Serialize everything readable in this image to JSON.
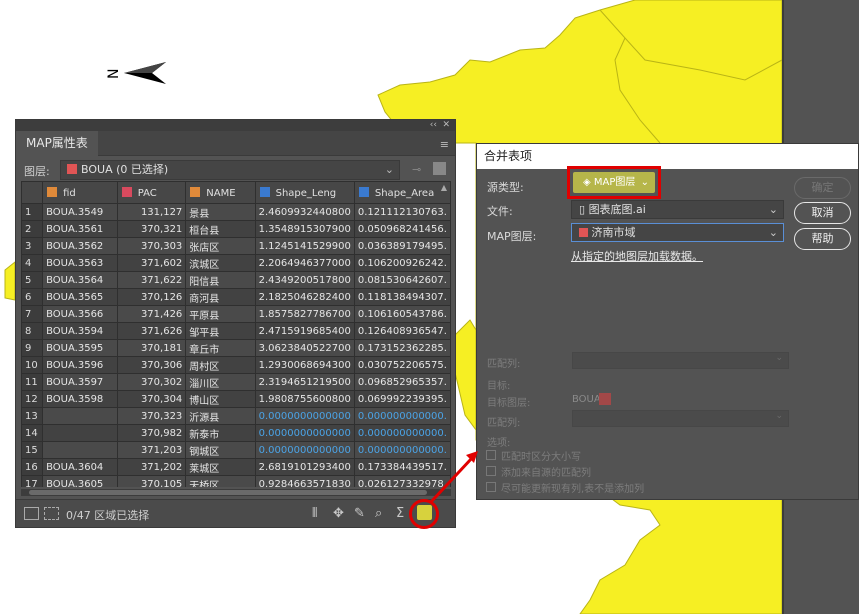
{
  "attr_panel": {
    "title": "MAP属性表",
    "layer_label": "图层:",
    "layer_value": "BOUA (0 已选择)",
    "columns": [
      "fid",
      "PAC",
      "NAME",
      "Shape_Leng",
      "Shape_Area"
    ],
    "rows": [
      {
        "n": "1",
        "fid": "BOUA.3549",
        "pac": "131,127",
        "name": "景县",
        "len": "2.4609932440800",
        "area": "0.121112130763."
      },
      {
        "n": "2",
        "fid": "BOUA.3561",
        "pac": "370,321",
        "name": "桓台县",
        "len": "1.3548915307900",
        "area": "0.050968241456."
      },
      {
        "n": "3",
        "fid": "BOUA.3562",
        "pac": "370,303",
        "name": "张店区",
        "len": "1.1245141529900",
        "area": "0.036389179495."
      },
      {
        "n": "4",
        "fid": "BOUA.3563",
        "pac": "371,602",
        "name": "滨城区",
        "len": "2.2064946377000",
        "area": "0.106200926242."
      },
      {
        "n": "5",
        "fid": "BOUA.3564",
        "pac": "371,622",
        "name": "阳信县",
        "len": "2.4349200517800",
        "area": "0.081530642607."
      },
      {
        "n": "6",
        "fid": "BOUA.3565",
        "pac": "370,126",
        "name": "商河县",
        "len": "2.1825046282400",
        "area": "0.118138494307."
      },
      {
        "n": "7",
        "fid": "BOUA.3566",
        "pac": "371,426",
        "name": "平原县",
        "len": "1.8575827786700",
        "area": "0.106160543786."
      },
      {
        "n": "8",
        "fid": "BOUA.3594",
        "pac": "371,626",
        "name": "邹平县",
        "len": "2.4715919685400",
        "area": "0.126408936547."
      },
      {
        "n": "9",
        "fid": "BOUA.3595",
        "pac": "370,181",
        "name": "章丘市",
        "len": "3.0623840522700",
        "area": "0.173152362285."
      },
      {
        "n": "10",
        "fid": "BOUA.3596",
        "pac": "370,306",
        "name": "周村区",
        "len": "1.2930068694300",
        "area": "0.030752206575."
      },
      {
        "n": "11",
        "fid": "BOUA.3597",
        "pac": "370,302",
        "name": "淄川区",
        "len": "2.3194651219500",
        "area": "0.096852965357."
      },
      {
        "n": "12",
        "fid": "BOUA.3598",
        "pac": "370,304",
        "name": "博山区",
        "len": "1.9808755600800",
        "area": "0.069992239395."
      },
      {
        "n": "13",
        "fid": "",
        "pac": "370,323",
        "name": "沂源县",
        "len": "0.0000000000000",
        "area": "0.000000000000."
      },
      {
        "n": "14",
        "fid": "",
        "pac": "370,982",
        "name": "新泰市",
        "len": "0.0000000000000",
        "area": "0.000000000000."
      },
      {
        "n": "15",
        "fid": "",
        "pac": "371,203",
        "name": "钢城区",
        "len": "0.0000000000000",
        "area": "0.000000000000."
      },
      {
        "n": "16",
        "fid": "BOUA.3604",
        "pac": "371,202",
        "name": "莱城区",
        "len": "2.6819101293400",
        "area": "0.173384439517."
      },
      {
        "n": "17",
        "fid": "BOUA.3605",
        "pac": "370,105",
        "name": "天桥区",
        "len": "0.9284663571830",
        "area": "0.026127332978."
      }
    ],
    "status_text": "0/47 区域已选择"
  },
  "merge_dialog": {
    "title": "合并表项",
    "source_type_label": "源类型:",
    "source_type_value": "MAP图层",
    "file_label": "文件:",
    "file_value": "图表底图.ai",
    "map_layer_label": "MAP图层:",
    "map_layer_value": "济南市域",
    "load_link": "从指定的地图层加载数据。",
    "ok_label": "确定",
    "cancel_label": "取消",
    "help_label": "帮助",
    "match_col_label": "匹配列:",
    "target_label": "目标:",
    "target_layer_label": "目标图层:",
    "target_layer_value": "BOUA",
    "target_match_label": "匹配列:",
    "options_label": "选项:",
    "option1": "匹配时区分大小写",
    "option2": "添加来自源的匹配列",
    "option3": "尽可能更新现有列,表不是添加列"
  },
  "colors": {
    "map_fill": "#f6ef23",
    "map_stroke": "#b9b416",
    "highlight": "#e00000",
    "accent": "#b6b64a"
  }
}
